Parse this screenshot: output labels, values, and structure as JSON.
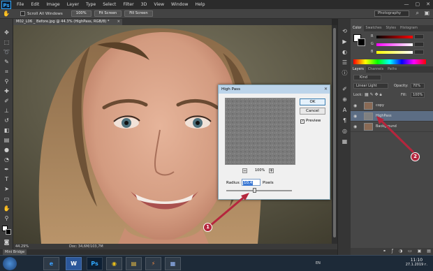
{
  "app": {
    "logo": "Ps"
  },
  "menu": [
    "File",
    "Edit",
    "Image",
    "Layer",
    "Type",
    "Select",
    "Filter",
    "3D",
    "View",
    "Window",
    "Help"
  ],
  "window_controls": [
    "—",
    "▢",
    "✕"
  ],
  "options": {
    "scroll_all_label": "Scroll All Windows",
    "buttons": [
      "100%",
      "Fit Screen",
      "Fill Screen"
    ],
    "workspace": "Photography"
  },
  "document": {
    "tab_title": "M02_L06 _ Before.jpg @ 44.3% (HighPass, RGB/8) *",
    "close": "×"
  },
  "status": {
    "zoom": "44.29%",
    "doc": "Doc: 34,6M/103,7M",
    "mini_bridge": "Mini Bridge"
  },
  "color_panel": {
    "tabs": [
      "Color",
      "Swatches",
      "Styles",
      "Histogram"
    ],
    "r": "R",
    "g": "G",
    "b": "B"
  },
  "layers_panel": {
    "tabs": [
      "Layers",
      "Channels",
      "Paths"
    ],
    "kind": "Kind",
    "blend": "Linear Light",
    "opacity_label": "Opacity:",
    "opacity_value": "70%",
    "lock_label": "Lock:",
    "fill_label": "Fill:",
    "fill_value": "100%",
    "layers": [
      {
        "name": "copy",
        "selected": false
      },
      {
        "name": "HighPass",
        "selected": true
      },
      {
        "name": "Background",
        "selected": false
      }
    ]
  },
  "high_pass": {
    "title": "High Pass",
    "ok": "OK",
    "cancel": "Cancel",
    "preview_label": "Preview",
    "preview_checked": true,
    "zoom": "100%",
    "zoom_out": "−",
    "zoom_in": "+",
    "radius_label": "Radius:",
    "radius_value": "10,4",
    "unit": "Pixels",
    "close": "✕",
    "slider_fraction": 0.43
  },
  "callouts": [
    "1",
    "2"
  ],
  "taskbar": {
    "apps": [
      "e",
      "W",
      "Ps",
      "◉",
      "▤",
      "⚡",
      "▦"
    ],
    "lang": "EN",
    "time": "11:10",
    "date": "27.1.2019 г."
  },
  "colors": {
    "callout": "#b5263d",
    "selection": "#5c6d84",
    "accent": "#31a8ff"
  }
}
